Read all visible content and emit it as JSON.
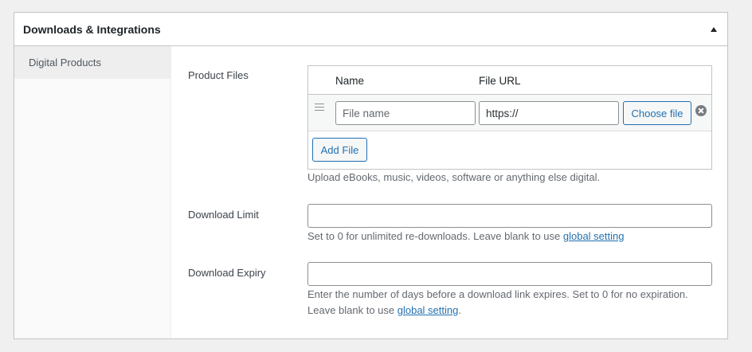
{
  "postbox": {
    "title": "Downloads & Integrations"
  },
  "tabs": [
    {
      "label": "Digital Products"
    }
  ],
  "product_files": {
    "label": "Product Files",
    "columns": {
      "name": "Name",
      "url": "File URL"
    },
    "row": {
      "name_placeholder": "File name",
      "url_value": "https://",
      "choose_label": "Choose file"
    },
    "add_label": "Add File",
    "description": "Upload eBooks, music, videos, software or anything else digital."
  },
  "download_limit": {
    "label": "Download Limit",
    "value": "",
    "desc_text": "Set to 0 for unlimited re-downloads. Leave blank to use ",
    "desc_link": "global setting"
  },
  "download_expiry": {
    "label": "Download Expiry",
    "value": "",
    "desc_line1": "Enter the number of days before a download link expires. Set to 0 for no expiration.",
    "desc_line2_prefix": "Leave blank to use ",
    "desc_link": "global setting",
    "desc_line2_suffix": "."
  }
}
